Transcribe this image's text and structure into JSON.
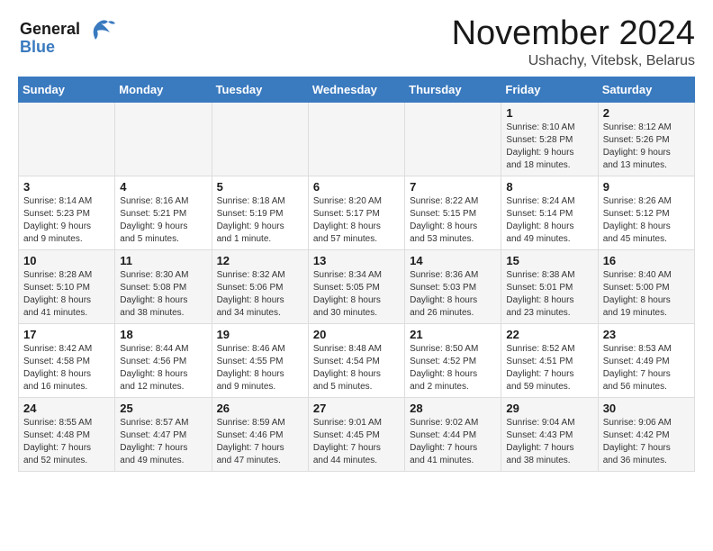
{
  "header": {
    "logo_line1": "General",
    "logo_line2": "Blue",
    "month_title": "November 2024",
    "location": "Ushachy, Vitebsk, Belarus"
  },
  "days_of_week": [
    "Sunday",
    "Monday",
    "Tuesday",
    "Wednesday",
    "Thursday",
    "Friday",
    "Saturday"
  ],
  "weeks": [
    [
      {
        "num": "",
        "detail": ""
      },
      {
        "num": "",
        "detail": ""
      },
      {
        "num": "",
        "detail": ""
      },
      {
        "num": "",
        "detail": ""
      },
      {
        "num": "",
        "detail": ""
      },
      {
        "num": "1",
        "detail": "Sunrise: 8:10 AM\nSunset: 5:28 PM\nDaylight: 9 hours\nand 18 minutes."
      },
      {
        "num": "2",
        "detail": "Sunrise: 8:12 AM\nSunset: 5:26 PM\nDaylight: 9 hours\nand 13 minutes."
      }
    ],
    [
      {
        "num": "3",
        "detail": "Sunrise: 8:14 AM\nSunset: 5:23 PM\nDaylight: 9 hours\nand 9 minutes."
      },
      {
        "num": "4",
        "detail": "Sunrise: 8:16 AM\nSunset: 5:21 PM\nDaylight: 9 hours\nand 5 minutes."
      },
      {
        "num": "5",
        "detail": "Sunrise: 8:18 AM\nSunset: 5:19 PM\nDaylight: 9 hours\nand 1 minute."
      },
      {
        "num": "6",
        "detail": "Sunrise: 8:20 AM\nSunset: 5:17 PM\nDaylight: 8 hours\nand 57 minutes."
      },
      {
        "num": "7",
        "detail": "Sunrise: 8:22 AM\nSunset: 5:15 PM\nDaylight: 8 hours\nand 53 minutes."
      },
      {
        "num": "8",
        "detail": "Sunrise: 8:24 AM\nSunset: 5:14 PM\nDaylight: 8 hours\nand 49 minutes."
      },
      {
        "num": "9",
        "detail": "Sunrise: 8:26 AM\nSunset: 5:12 PM\nDaylight: 8 hours\nand 45 minutes."
      }
    ],
    [
      {
        "num": "10",
        "detail": "Sunrise: 8:28 AM\nSunset: 5:10 PM\nDaylight: 8 hours\nand 41 minutes."
      },
      {
        "num": "11",
        "detail": "Sunrise: 8:30 AM\nSunset: 5:08 PM\nDaylight: 8 hours\nand 38 minutes."
      },
      {
        "num": "12",
        "detail": "Sunrise: 8:32 AM\nSunset: 5:06 PM\nDaylight: 8 hours\nand 34 minutes."
      },
      {
        "num": "13",
        "detail": "Sunrise: 8:34 AM\nSunset: 5:05 PM\nDaylight: 8 hours\nand 30 minutes."
      },
      {
        "num": "14",
        "detail": "Sunrise: 8:36 AM\nSunset: 5:03 PM\nDaylight: 8 hours\nand 26 minutes."
      },
      {
        "num": "15",
        "detail": "Sunrise: 8:38 AM\nSunset: 5:01 PM\nDaylight: 8 hours\nand 23 minutes."
      },
      {
        "num": "16",
        "detail": "Sunrise: 8:40 AM\nSunset: 5:00 PM\nDaylight: 8 hours\nand 19 minutes."
      }
    ],
    [
      {
        "num": "17",
        "detail": "Sunrise: 8:42 AM\nSunset: 4:58 PM\nDaylight: 8 hours\nand 16 minutes."
      },
      {
        "num": "18",
        "detail": "Sunrise: 8:44 AM\nSunset: 4:56 PM\nDaylight: 8 hours\nand 12 minutes."
      },
      {
        "num": "19",
        "detail": "Sunrise: 8:46 AM\nSunset: 4:55 PM\nDaylight: 8 hours\nand 9 minutes."
      },
      {
        "num": "20",
        "detail": "Sunrise: 8:48 AM\nSunset: 4:54 PM\nDaylight: 8 hours\nand 5 minutes."
      },
      {
        "num": "21",
        "detail": "Sunrise: 8:50 AM\nSunset: 4:52 PM\nDaylight: 8 hours\nand 2 minutes."
      },
      {
        "num": "22",
        "detail": "Sunrise: 8:52 AM\nSunset: 4:51 PM\nDaylight: 7 hours\nand 59 minutes."
      },
      {
        "num": "23",
        "detail": "Sunrise: 8:53 AM\nSunset: 4:49 PM\nDaylight: 7 hours\nand 56 minutes."
      }
    ],
    [
      {
        "num": "24",
        "detail": "Sunrise: 8:55 AM\nSunset: 4:48 PM\nDaylight: 7 hours\nand 52 minutes."
      },
      {
        "num": "25",
        "detail": "Sunrise: 8:57 AM\nSunset: 4:47 PM\nDaylight: 7 hours\nand 49 minutes."
      },
      {
        "num": "26",
        "detail": "Sunrise: 8:59 AM\nSunset: 4:46 PM\nDaylight: 7 hours\nand 47 minutes."
      },
      {
        "num": "27",
        "detail": "Sunrise: 9:01 AM\nSunset: 4:45 PM\nDaylight: 7 hours\nand 44 minutes."
      },
      {
        "num": "28",
        "detail": "Sunrise: 9:02 AM\nSunset: 4:44 PM\nDaylight: 7 hours\nand 41 minutes."
      },
      {
        "num": "29",
        "detail": "Sunrise: 9:04 AM\nSunset: 4:43 PM\nDaylight: 7 hours\nand 38 minutes."
      },
      {
        "num": "30",
        "detail": "Sunrise: 9:06 AM\nSunset: 4:42 PM\nDaylight: 7 hours\nand 36 minutes."
      }
    ]
  ]
}
